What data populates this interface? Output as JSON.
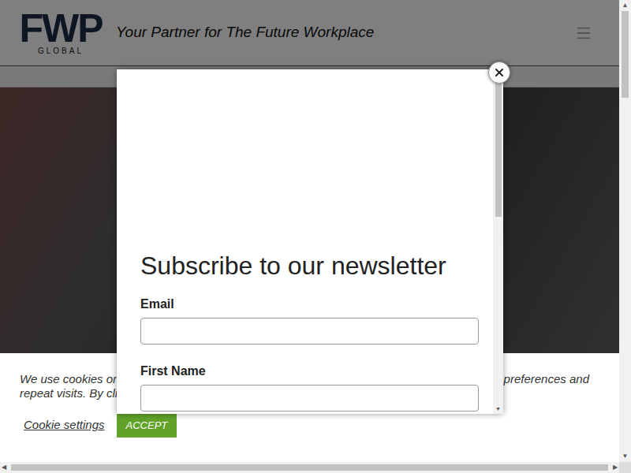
{
  "header": {
    "logo": {
      "mark": "FWP",
      "sub": "GLOBAL"
    },
    "tagline": "Your Partner for The Future Workplace"
  },
  "cookie_banner": {
    "lines": [
      {
        "left": "We use cookies on",
        "right": "preferences and"
      },
      {
        "left": "repeat visits. By cli",
        "right": ""
      }
    ],
    "settings_link": "Cookie settings",
    "accept_button": "ACCEPT"
  },
  "modal": {
    "title": "Subscribe to our newsletter",
    "fields": [
      {
        "label": "Email",
        "value": ""
      },
      {
        "label": "First Name",
        "value": ""
      }
    ]
  }
}
